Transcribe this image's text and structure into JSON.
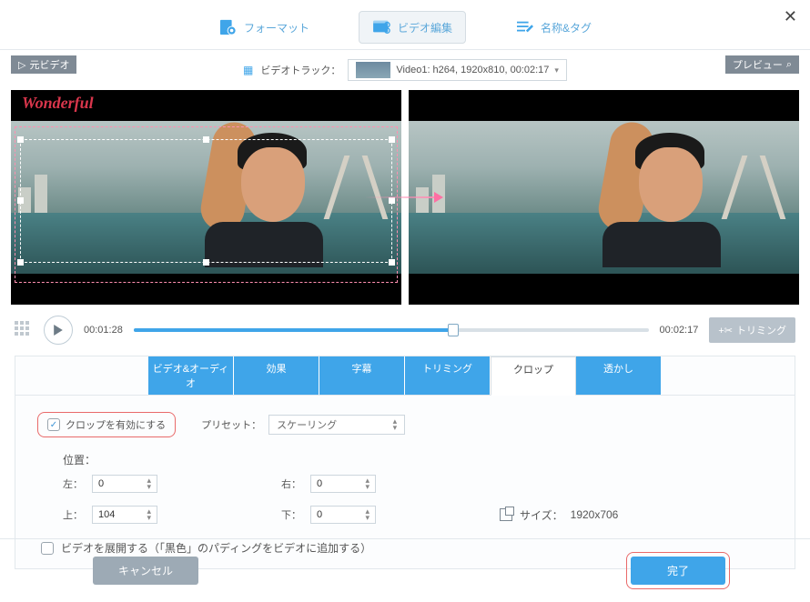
{
  "tabs": {
    "format": "フォーマット",
    "edit": "ビデオ編集",
    "tags": "名称&タグ"
  },
  "track": {
    "label": "ビデオトラック：",
    "value": "Video1: h264, 1920x810, 00:02:17"
  },
  "tags_lr": {
    "left": "元ビデオ",
    "right": "プレビュー"
  },
  "watermark": "Wonderful",
  "transport": {
    "current": "00:01:28",
    "total": "00:02:17",
    "trim": "トリミング"
  },
  "edit_tabs": [
    "ビデオ&オーディオ",
    "効果",
    "字幕",
    "トリミング",
    "クロップ",
    "透かし"
  ],
  "crop": {
    "enable": "クロップを有効にする",
    "preset_label": "プリセット：",
    "preset_value": "スケーリング",
    "position_label": "位置：",
    "left_label": "左：",
    "left_val": "0",
    "right_label": "右：",
    "right_val": "0",
    "top_label": "上：",
    "top_val": "104",
    "bottom_label": "下：",
    "bottom_val": "0",
    "size_label": "サイズ：",
    "size_val": "1920x706",
    "expand": "ビデオを展開する（「黒色」のパディングをビデオに追加する）"
  },
  "footer": {
    "cancel": "キャンセル",
    "done": "完了"
  }
}
